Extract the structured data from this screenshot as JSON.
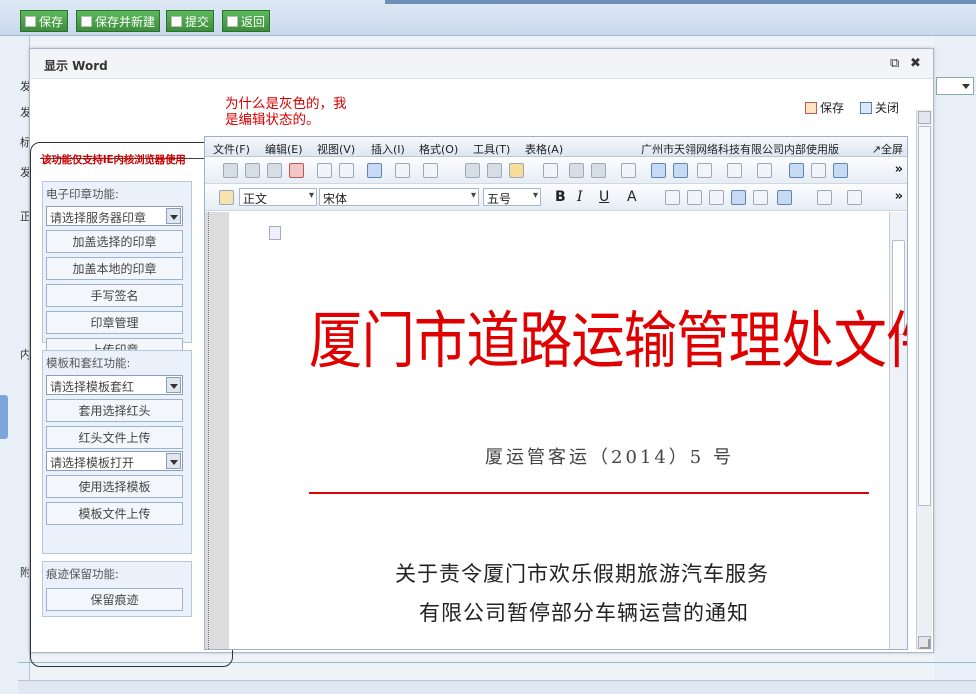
{
  "toolbar": {
    "save": "保存",
    "save_new": "保存并新建",
    "submit": "提交",
    "back": "返回"
  },
  "bg_labels": [
    "发",
    "发",
    "标",
    "发",
    "正",
    "内",
    "附"
  ],
  "modal": {
    "title": "显示 Word",
    "save": "保存",
    "close": "关闭"
  },
  "annotation": {
    "line1": "为什么是灰色的，我",
    "line2": "是编辑状态的。"
  },
  "notice": "该功能仅支持IE内核浏览器使用",
  "seal_panel": {
    "label": "电子印章功能:",
    "select": "请选择服务器印章",
    "buttons": [
      "加盖选择的印章",
      "加盖本地的印章",
      "手写签名",
      "印章管理",
      "上传印章"
    ]
  },
  "template_panel": {
    "label": "模板和套红功能:",
    "select1": "请选择模板套红",
    "btn1": "套用选择红头",
    "btn2": "红头文件上传",
    "select2": "请选择模板打开",
    "btn3": "使用选择模板",
    "btn4": "模板文件上传"
  },
  "trace_panel": {
    "label": "痕迹保留功能:",
    "btn": "保留痕迹"
  },
  "word": {
    "menus": [
      "文件(F)",
      "编辑(E)",
      "视图(V)",
      "插入(I)",
      "格式(O)",
      "工具(T)",
      "表格(A)"
    ],
    "brand": "广州市天翎网络科技有限公司内部使用版",
    "fullscreen": "↗全屏",
    "style": "正文",
    "font": "宋体",
    "size": "五号"
  },
  "document": {
    "title": "厦门市道路运输管理处文件",
    "number": "厦运管客运（2014）5 号",
    "heading1": "关于责令厦门市欢乐假期旅游汽车服务",
    "heading2": "有限公司暂停部分车辆运营的通知"
  }
}
